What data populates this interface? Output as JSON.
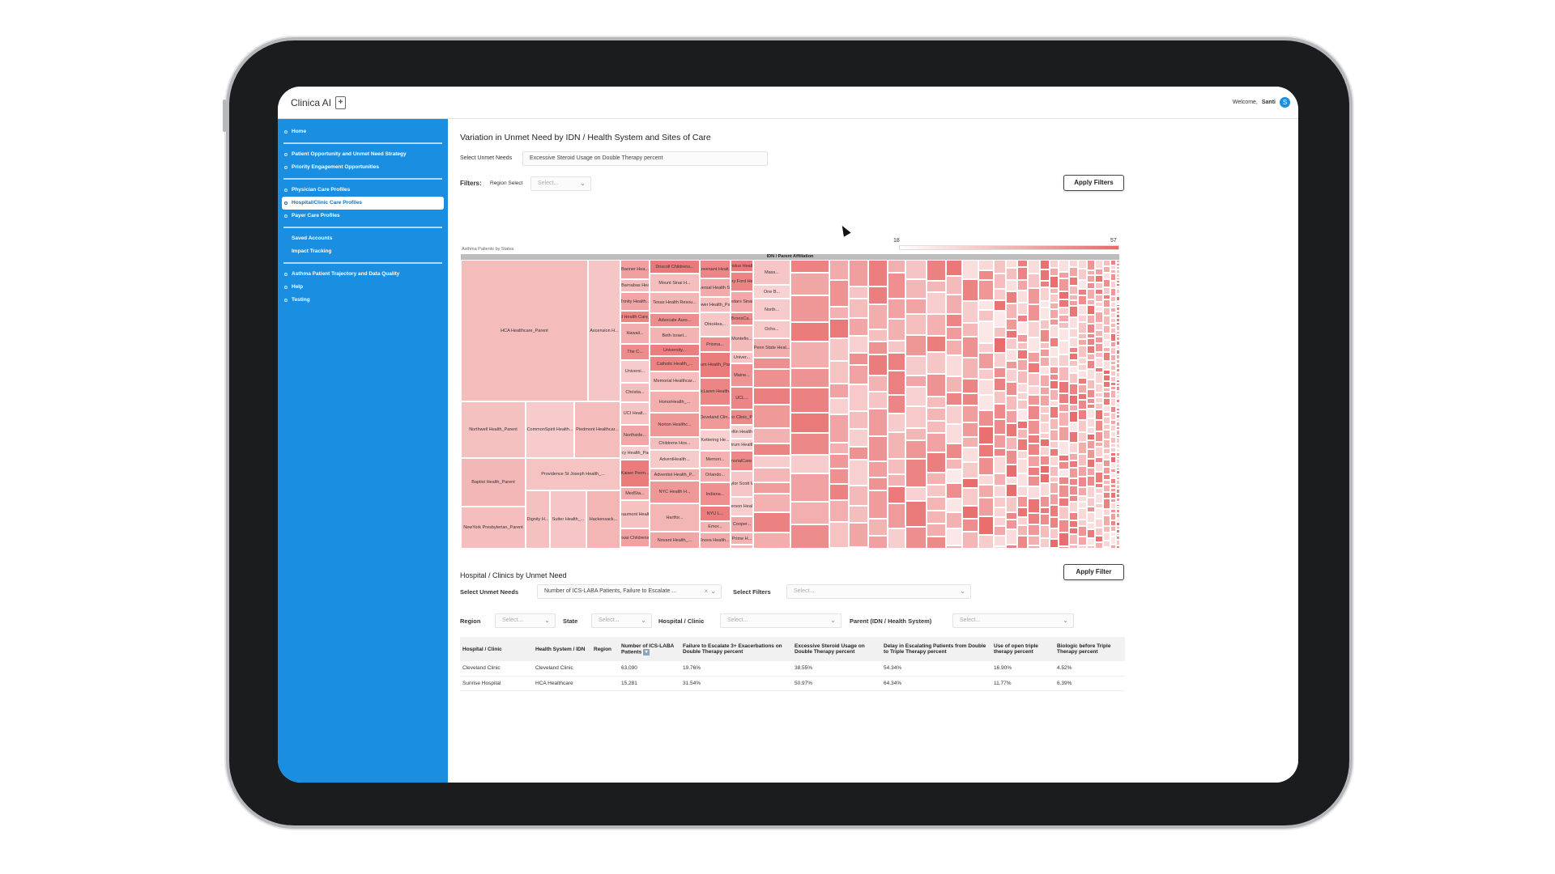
{
  "app": {
    "logo_text": "Clinica AI",
    "logo_icon": "clipboard-icon",
    "welcome_prefix": "Welcome,",
    "user_name": "Santi",
    "avatar_letter": "S"
  },
  "sidebar": {
    "accent": "#1a8ee0",
    "home": "Home",
    "g1": [
      "Patient Opportunity and Unmet Need Strategy",
      "Priority Engagement Opportunities"
    ],
    "g2": [
      "Physician Care Profiles",
      "Hospital/Clinic Care Profiles",
      "Payer Care Profiles"
    ],
    "g3": [
      "Saved Accounts",
      "Impact Tracking"
    ],
    "g4": [
      "Asthma Patient Trajectory and Data Quality",
      "Help",
      "Testing"
    ]
  },
  "section1": {
    "title": "Variation in Unmet Need by IDN / Health System and Sites of Care",
    "select_unmet_label": "Select Unmet Needs",
    "select_unmet_value": "Excessive Steroid Usage on Double Therapy percent",
    "filters_label": "Filters:",
    "region_select_label": "Region Select",
    "region_placeholder": "Select...",
    "apply_button": "Apply Filters"
  },
  "treemap": {
    "caption": "Asthma Patients by States",
    "header": "IDN / Parent Affiliation",
    "legend_min": "18",
    "legend_max": "57",
    "color_low": "#ffffff",
    "color_high": "#e86a6a",
    "labels": [
      "HCA Healthcare_Parent",
      "Ascension H...",
      "Northwell Health_Parent",
      "CommonSpirit Health...",
      "Piedmont Healthcar...",
      "Baptist Health_Parent",
      "Providence St Joseph Health_...",
      "Dignity H...",
      "Sutter Health_...",
      "Hackensack...",
      "NewYork Presbyterian_Parent",
      "Banner Hea...",
      "RWJBarnabas Health...",
      "Trinity Health...",
      "Steward Health Care_Parent",
      "Hawaii...",
      "The C...",
      "Universi...",
      "Christia...",
      "UCI Healt...",
      "Northside...",
      "Mercy Health_Parent",
      "Kaiser Perm...",
      "MedSta...",
      "Beaumont Healt...",
      "Texas Childrens...",
      "Driscoll Childrens...",
      "Mount Sinai H...",
      "Texas Health Resou...",
      "Advocate Auro...",
      "Beth Israel...",
      "University...",
      "Catholic Health_...",
      "Memorial Healthcar...",
      "HonorHealth_...",
      "Norton Healthc...",
      "Childrens Hos...",
      "AdventHealth...",
      "Adventist Health_P...",
      "NYC Health H...",
      "Hartfor...",
      "Novant Health_...",
      "Covenant Healt...",
      "Universal Health Ser...",
      "Tower Health_Pa...",
      "OhioHea...",
      "Prisma...",
      "Atrium Health_Parent",
      "McLaren Health...",
      "Cleveland Clin...",
      "Kettering He...",
      "Memori...",
      "Orlando...",
      "Indiana...",
      "NYU L...",
      "Emor...",
      "Inova Health...",
      "Christus Health...",
      "Henry Ford Heal...",
      "Cedars Sinai...",
      "BronxCa...",
      "Montefio...",
      "Univer...",
      "Maine...",
      "UCL...",
      "Mayo Clinic_Par...",
      "Bellin Health...",
      "Spectrum Health_P...",
      "MemorialCare H...",
      "Baylor Scott W...",
      "Jefferson Health...",
      "Cooper...",
      "Prime H...",
      "Mass...",
      "One B...",
      "North...",
      "Ochs...",
      "Penn State Heal..."
    ]
  },
  "section2": {
    "title": "Hospital / Clinics by Unmet Need",
    "apply_button": "Apply Filter",
    "select_unmet_label": "Select Unmet Needs",
    "select_unmet_value": "Number of ICS-LABA Patients, Failure to Escalate ...",
    "select_filters_label": "Select Filters",
    "select_filters_placeholder": "Select...",
    "region_label": "Region",
    "state_label": "State",
    "hospital_label": "Hospital / Clinic",
    "parent_label": "Parent (IDN / Health System)",
    "placeholder": "Select...",
    "columns": [
      "Hospital / Clinic",
      "Health System / IDN",
      "Region",
      "Number of ICS-LABA Patients",
      "Failure to Escalate 3+ Exacerbations on Double Therapy percent",
      "Excessive Steroid Usage on Double Therapy percent",
      "Delay in Escalating Patients from Double to Triple Therapy percent",
      "Use of open triple therapy percent",
      "Biologic before Triple Therapy percent"
    ],
    "rows": [
      [
        "Cleveland Clinic",
        "Cleveland Clinic",
        "",
        "63,090",
        "19.76%",
        "38.55%",
        "54.34%",
        "16.90%",
        "4.52%"
      ],
      [
        "Sunrise Hospital",
        "HCA Healthcare",
        "",
        "15,281",
        "31.54%",
        "50.97%",
        "64.34%",
        "11.77%",
        "6.39%"
      ]
    ]
  }
}
